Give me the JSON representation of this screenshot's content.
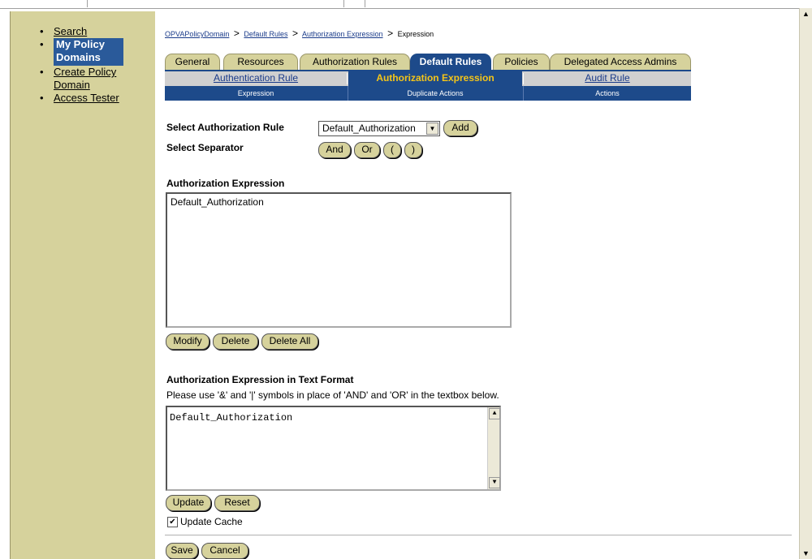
{
  "sidebar": {
    "items": [
      {
        "label": "Search"
      },
      {
        "label": "My Policy Domains"
      },
      {
        "label": "Create Policy Domain"
      },
      {
        "label": "Access Tester"
      }
    ]
  },
  "breadcrumb": {
    "items": [
      "OPVAPolicyDomain",
      "Default Rules",
      "Authorization Expression"
    ],
    "current": "Expression",
    "separator": ">"
  },
  "tabs": [
    "General",
    "Resources",
    "Authorization Rules",
    "Default Rules",
    "Policies",
    "Delegated Access Admins"
  ],
  "selected_tab": "Default Rules",
  "subtabs": [
    "Authentication Rule",
    "Authorization Expression",
    "Audit Rule"
  ],
  "selected_subtab": "Authorization Expression",
  "actions": [
    "Expression",
    "Duplicate Actions",
    "Actions"
  ],
  "form": {
    "select_rule_label": "Select Authorization Rule",
    "select_rule_value": "Default_Authorization",
    "add_label": "Add",
    "separator_label": "Select Separator",
    "separators": [
      "And",
      "Or",
      "(",
      ")"
    ],
    "expression_heading": "Authorization Expression",
    "expression_items": [
      "Default_Authorization"
    ],
    "modify_label": "Modify",
    "delete_label": "Delete",
    "delete_all_label": "Delete All",
    "text_format_heading": "Authorization Expression in Text Format",
    "text_format_hint": "Please use '&' and '|' symbols in place of 'AND' and 'OR' in the textbox below.",
    "text_format_value": "Default_Authorization",
    "update_label": "Update",
    "reset_label": "Reset",
    "update_cache_label": "Update Cache",
    "update_cache_checked": true,
    "save_label": "Save",
    "cancel_label": "Cancel"
  },
  "icons": {
    "dropdown": "chevron-down-icon",
    "scroll_up": "arrow-up-icon",
    "scroll_down": "arrow-down-icon",
    "checkbox": "check-icon"
  },
  "colors": {
    "sidebar_bg": "#d6d29c",
    "accent_blue": "#1d4a8a",
    "subtab_highlight": "#f5c518"
  }
}
